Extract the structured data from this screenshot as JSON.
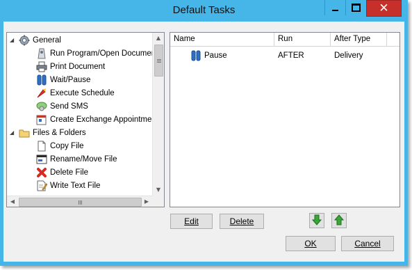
{
  "window": {
    "title": "Default Tasks",
    "controls": {
      "minimize": "minimize-icon",
      "maximize": "maximize-icon",
      "close": "✕"
    }
  },
  "tree": {
    "groups": [
      {
        "label": "General",
        "icon": "gear-icon",
        "expanded": true,
        "items": [
          {
            "label": "Run Program/Open Document",
            "icon": "run-program-icon"
          },
          {
            "label": "Print Document",
            "icon": "printer-icon"
          },
          {
            "label": "Wait/Pause",
            "icon": "pause-icon"
          },
          {
            "label": "Execute Schedule",
            "icon": "execute-schedule-icon"
          },
          {
            "label": "Send SMS",
            "icon": "sms-icon"
          },
          {
            "label": "Create Exchange Appointment",
            "icon": "appointment-icon"
          }
        ]
      },
      {
        "label": "Files & Folders",
        "icon": "folder-icon",
        "expanded": true,
        "items": [
          {
            "label": "Copy File",
            "icon": "copy-file-icon"
          },
          {
            "label": "Rename/Move File",
            "icon": "rename-file-icon"
          },
          {
            "label": "Delete File",
            "icon": "delete-file-icon"
          },
          {
            "label": "Write Text File",
            "icon": "write-text-file-icon"
          }
        ]
      }
    ],
    "expand_arrow": "◢"
  },
  "task_grid": {
    "columns": [
      "Name",
      "Run",
      "After Type"
    ],
    "rows": [
      {
        "name": "Pause",
        "icon": "pause-icon",
        "run": "AFTER",
        "after_type": "Delivery"
      }
    ]
  },
  "buttons": {
    "edit": "Edit",
    "delete": "Delete",
    "move_down": "move-down-icon",
    "move_up": "move-up-icon",
    "ok": "OK",
    "cancel": "Cancel"
  },
  "scroll_glyphs": {
    "up": "▲",
    "down": "▼",
    "left": "◀",
    "right": "▶"
  },
  "colors": {
    "titlebar": "#46b5e8",
    "close_button": "#c7302a",
    "client_bg": "#f0f0f0",
    "arrow_green": "#3aa63a"
  }
}
